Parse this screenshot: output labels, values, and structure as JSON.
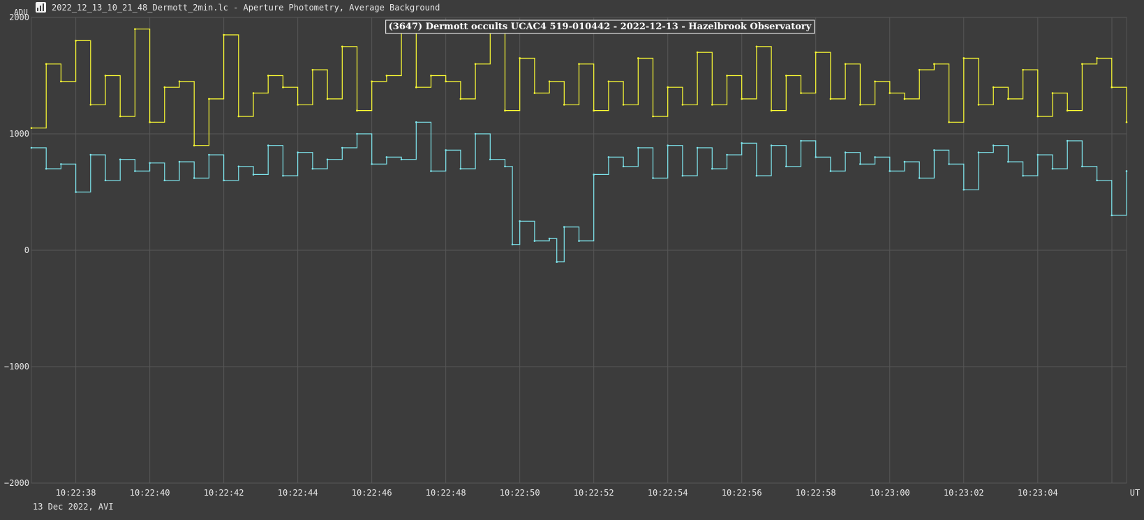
{
  "window": {
    "title": "2022_12_13_10_21_48_Dermott_2min.lc - Aperture Photometry, Average Background",
    "icon": "chart-icon"
  },
  "footer": {
    "note": "13 Dec 2022, AVI"
  },
  "chart_data": {
    "type": "line",
    "title": "(3647) Dermott occults UCAC4 519-010442 - 2022-12-13 - Hazelbrook Observatory",
    "ylabel": "ADU",
    "xlabel": "UT",
    "ylim": [
      -2000,
      2000
    ],
    "y_ticks": [
      "2000",
      "1000",
      "0",
      "−1000",
      "−2000"
    ],
    "y_tick_values": [
      2000,
      1000,
      0,
      -1000,
      -2000
    ],
    "x_ticks": [
      "10:22:38",
      "10:22:40",
      "10:22:42",
      "10:22:44",
      "10:22:46",
      "10:22:48",
      "10:22:50",
      "10:22:52",
      "10:22:54",
      "10:22:56",
      "10:22:58",
      "10:23:00",
      "10:23:02",
      "10:23:04"
    ],
    "x_tick_values": [
      38,
      40,
      42,
      44,
      46,
      48,
      50,
      52,
      54,
      56,
      58,
      60,
      62,
      64
    ],
    "xlim": [
      36.8,
      66.4
    ],
    "x_units": "seconds after 10:22:00",
    "grid": true,
    "series": [
      {
        "color": "#ffff33",
        "x": [
          36.8,
          37.2,
          37.6,
          38.0,
          38.4,
          38.8,
          39.2,
          39.6,
          40.0,
          40.4,
          40.8,
          41.2,
          41.6,
          42.0,
          42.4,
          42.8,
          43.2,
          43.6,
          44.0,
          44.4,
          44.8,
          45.2,
          45.6,
          46.0,
          46.4,
          46.8,
          47.2,
          47.6,
          48.0,
          48.4,
          48.8,
          49.2,
          49.6,
          50.0,
          50.4,
          50.8,
          51.2,
          51.6,
          52.0,
          52.4,
          52.8,
          53.2,
          53.6,
          54.0,
          54.4,
          54.8,
          55.2,
          55.6,
          56.0,
          56.4,
          56.8,
          57.2,
          57.6,
          58.0,
          58.4,
          58.8,
          59.2,
          59.6,
          60.0,
          60.4,
          60.8,
          61.2,
          61.6,
          62.0,
          62.4,
          62.8,
          63.2,
          63.6,
          64.0,
          64.4,
          64.8,
          65.2,
          65.6,
          66.0,
          66.4
        ],
        "values": [
          1050,
          1600,
          1450,
          1800,
          1250,
          1500,
          1150,
          1900,
          1100,
          1400,
          1450,
          900,
          1300,
          1850,
          1150,
          1350,
          1500,
          1400,
          1250,
          1550,
          1300,
          1750,
          1200,
          1450,
          1500,
          1950,
          1400,
          1500,
          1450,
          1300,
          1600,
          1950,
          1200,
          1650,
          1350,
          1450,
          1250,
          1600,
          1200,
          1450,
          1250,
          1650,
          1150,
          1400,
          1250,
          1700,
          1250,
          1500,
          1300,
          1750,
          1200,
          1500,
          1350,
          1700,
          1300,
          1600,
          1250,
          1450,
          1350,
          1300,
          1550,
          1600,
          1100,
          1650,
          1250,
          1400,
          1300,
          1550,
          1150,
          1350,
          1200,
          1600,
          1650,
          1400,
          1100
        ]
      },
      {
        "color": "#7fe8f0",
        "x": [
          36.8,
          37.2,
          37.6,
          38.0,
          38.4,
          38.8,
          39.2,
          39.6,
          40.0,
          40.4,
          40.8,
          41.2,
          41.6,
          42.0,
          42.4,
          42.8,
          43.2,
          43.6,
          44.0,
          44.4,
          44.8,
          45.2,
          45.6,
          46.0,
          46.4,
          46.8,
          47.2,
          47.6,
          48.0,
          48.4,
          48.8,
          49.2,
          49.6,
          49.8,
          50.0,
          50.4,
          50.8,
          51.0,
          51.2,
          51.6,
          52.0,
          52.4,
          52.8,
          53.2,
          53.6,
          54.0,
          54.4,
          54.8,
          55.2,
          55.6,
          56.0,
          56.4,
          56.8,
          57.2,
          57.6,
          58.0,
          58.4,
          58.8,
          59.2,
          59.6,
          60.0,
          60.4,
          60.8,
          61.2,
          61.6,
          62.0,
          62.4,
          62.8,
          63.2,
          63.6,
          64.0,
          64.4,
          64.8,
          65.2,
          65.6,
          66.0,
          66.4
        ],
        "values": [
          880,
          700,
          740,
          500,
          820,
          600,
          780,
          680,
          750,
          600,
          760,
          620,
          820,
          600,
          720,
          650,
          900,
          640,
          840,
          700,
          780,
          880,
          1000,
          740,
          800,
          780,
          1100,
          680,
          860,
          700,
          1000,
          780,
          720,
          50,
          250,
          80,
          100,
          -100,
          200,
          80,
          650,
          800,
          720,
          880,
          620,
          900,
          640,
          880,
          700,
          820,
          920,
          640,
          900,
          720,
          940,
          800,
          680,
          840,
          740,
          800,
          680,
          760,
          620,
          860,
          740,
          520,
          840,
          900,
          760,
          640,
          820,
          700,
          940,
          720,
          600,
          300,
          680
        ]
      }
    ]
  }
}
